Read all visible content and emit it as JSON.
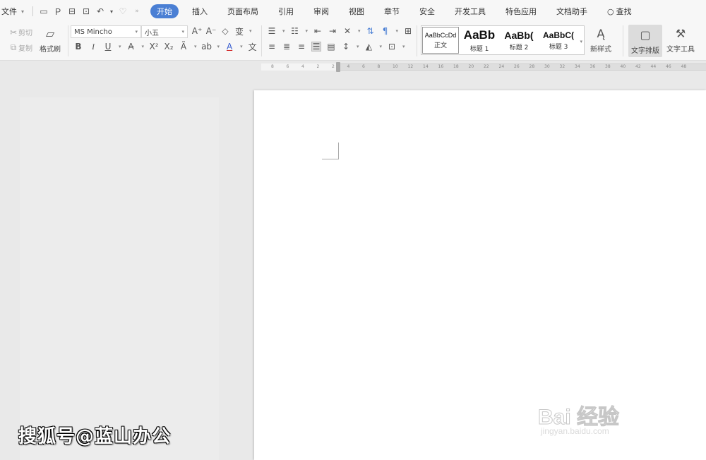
{
  "menu": {
    "file_label": "文件",
    "tabs": [
      {
        "label": "开始",
        "active": true
      },
      {
        "label": "插入"
      },
      {
        "label": "页面布局"
      },
      {
        "label": "引用"
      },
      {
        "label": "审阅"
      },
      {
        "label": "视图"
      },
      {
        "label": "章节"
      },
      {
        "label": "安全"
      },
      {
        "label": "开发工具"
      },
      {
        "label": "特色应用"
      },
      {
        "label": "文档助手"
      }
    ],
    "search_label": "查找"
  },
  "ribbon": {
    "cut_label": "剪切",
    "copy_label": "复制",
    "format_painter_label": "格式刷",
    "font_name": "MS Mincho",
    "font_size": "小五",
    "styles": [
      {
        "preview": "AaBbCcDd",
        "label": "正文"
      },
      {
        "preview": "AaBb",
        "label": "标题 1"
      },
      {
        "preview": "AaBb(",
        "label": "标题 2"
      },
      {
        "preview": "AaBbC(",
        "label": "标题 3"
      }
    ],
    "new_style_label": "新样式",
    "find_replace_label": "文字排版",
    "text_tools_label": "文字工具"
  },
  "ruler": {
    "numbers": [
      "8",
      "6",
      "4",
      "2",
      "2",
      "4",
      "6",
      "8",
      "10",
      "12",
      "14",
      "16",
      "18",
      "20",
      "22",
      "24",
      "26",
      "28",
      "30",
      "32",
      "34",
      "36",
      "38",
      "40",
      "42",
      "44",
      "46",
      "48"
    ]
  },
  "watermark": {
    "sohu": "搜狐号@蓝山办公",
    "baidu_main": "Bai 经验",
    "baidu_sub": "jingyan.baidu.com"
  },
  "colors": {
    "active_tab": "#4a7fd4",
    "ribbon_bg": "#f7f7f7",
    "workspace_bg": "#e9e9e9",
    "page_bg": "#ffffff"
  }
}
